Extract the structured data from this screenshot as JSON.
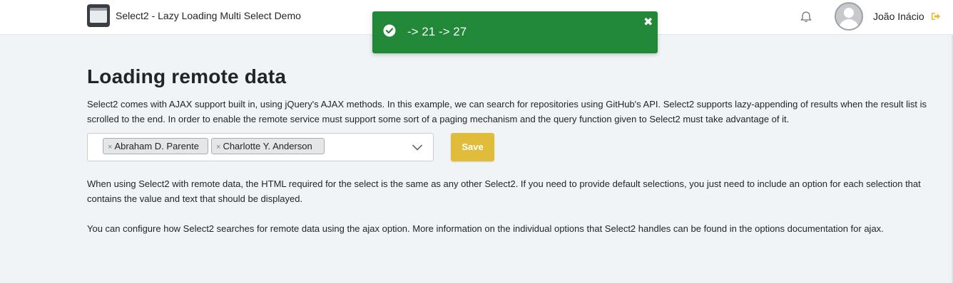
{
  "header": {
    "app_title": "Select2 - Lazy Loading Multi Select Demo",
    "user_name": "João Inácio"
  },
  "toast": {
    "message": "-> 21 -> 27",
    "close_glyph": "✖",
    "color": "#218838"
  },
  "main": {
    "title": "Loading remote data",
    "intro": "Select2 comes with AJAX support built in, using jQuery's AJAX methods. In this example, we can search for repositories using GitHub's API. Select2 supports lazy-appending of results when the result list is scrolled to the end. In order to enable the remote service must support some sort of a paging mechanism and the query function given to Select2 must take advantage of it.",
    "para2": "When using Select2 with remote data, the HTML required for the select is the same as any other Select2. If you need to provide default selections, you just need to include an option for each selection that contains the value and text that should be displayed.",
    "para3": "You can configure how Select2 searches for remote data using the ajax option. More information on the individual options that Select2 handles can be found in the options documentation for ajax."
  },
  "select": {
    "selected": [
      {
        "label": "Abraham D. Parente",
        "remove": "×"
      },
      {
        "label": "Charlotte Y. Anderson",
        "remove": "×"
      }
    ]
  },
  "save_button": {
    "label": "Save",
    "color": "#e0bc3a"
  },
  "icons": {
    "app": "app-window-icon",
    "bell": "bell-icon",
    "avatar": "user-avatar-icon",
    "logout": "sign-out-icon",
    "check": "check-circle-icon",
    "close": "close-icon",
    "chevron": "chevron-down-icon"
  }
}
